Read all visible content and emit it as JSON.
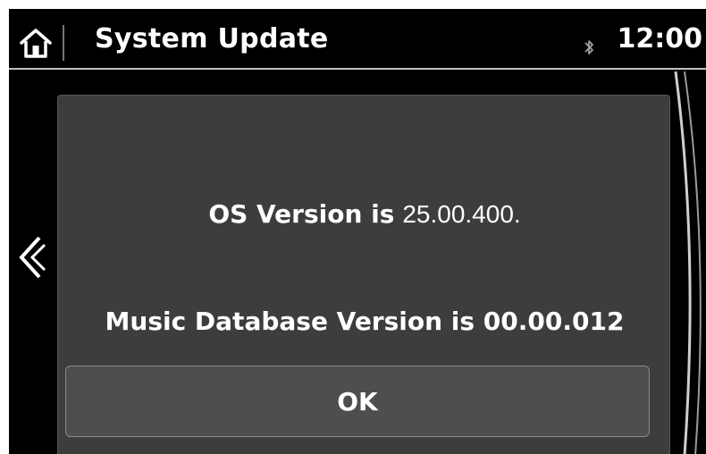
{
  "header": {
    "title": "System Update",
    "time": "12:00",
    "home_icon": "home-icon",
    "status_icon": "bluetooth-icon"
  },
  "nav": {
    "back_icon": "chevron-left-icon"
  },
  "dialog": {
    "os_label": "OS Version is",
    "os_version": "25.00.400.",
    "music_line": "Music Database Version is 00.00.012",
    "ok_label": "OK"
  },
  "colors": {
    "screen_bg": "#000000",
    "dialog_bg": "#3d3d3d",
    "button_bg": "#4e4e4e",
    "text": "#ffffff"
  }
}
